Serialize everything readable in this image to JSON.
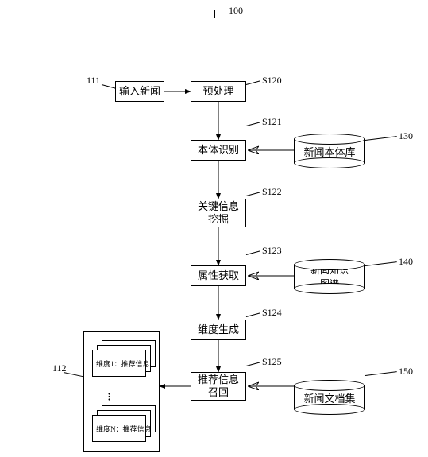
{
  "chart_data": {
    "type": "diagram",
    "title_label": "100",
    "nodes": [
      {
        "id": "111",
        "label_ref": "111",
        "text": "输入新闻"
      },
      {
        "id": "S120",
        "label_ref": "S120",
        "text": "预处理"
      },
      {
        "id": "S121",
        "label_ref": "S121",
        "text": "本体识别"
      },
      {
        "id": "S122",
        "label_ref": "S122",
        "text": "关键信息挖掘"
      },
      {
        "id": "S123",
        "label_ref": "S123",
        "text": "属性获取"
      },
      {
        "id": "S124",
        "label_ref": "S124",
        "text": "维度生成"
      },
      {
        "id": "S125",
        "label_ref": "S125",
        "text": "推荐信息召回"
      },
      {
        "id": "130",
        "label_ref": "130",
        "text": "新闻本体库",
        "shape": "cylinder"
      },
      {
        "id": "140",
        "label_ref": "140",
        "text": "新闻知识图谱",
        "shape": "cylinder"
      },
      {
        "id": "150",
        "label_ref": "150",
        "text": "新闻文档集",
        "shape": "cylinder"
      },
      {
        "id": "112",
        "label_ref": "112",
        "text_lines": [
          "维度1：推荐信息",
          "...",
          "维度N：推荐信息"
        ]
      }
    ],
    "edges": [
      {
        "from": "111",
        "to": "S120"
      },
      {
        "from": "S120",
        "to": "S121"
      },
      {
        "from": "S121",
        "to": "S122"
      },
      {
        "from": "S122",
        "to": "S123"
      },
      {
        "from": "S123",
        "to": "S124"
      },
      {
        "from": "S124",
        "to": "S125"
      },
      {
        "from": "130",
        "to": "S121",
        "style": "bold"
      },
      {
        "from": "140",
        "to": "S123",
        "style": "bold"
      },
      {
        "from": "150",
        "to": "S125",
        "style": "bold"
      },
      {
        "from": "S125",
        "to": "112"
      }
    ]
  },
  "labels": {
    "ref_100": "100",
    "ref_111": "111",
    "ref_112": "112",
    "ref_130": "130",
    "ref_140": "140",
    "ref_150": "150",
    "ref_S120": "S120",
    "ref_S121": "S121",
    "ref_S122": "S122",
    "ref_S123": "S123",
    "ref_S124": "S124",
    "ref_S125": "S125"
  },
  "boxes": {
    "input_news": "输入新闻",
    "preprocess": "预处理",
    "entity_rec": "本体识别",
    "key_info": "关键信息\n挖掘",
    "attr_get": "属性获取",
    "dim_gen": "维度生成",
    "rec_recall": "推荐信息\n召回"
  },
  "cylinders": {
    "c130": "新闻本体库",
    "c140": "新闻知识\n图谱",
    "c150": "新闻文档集"
  },
  "output": {
    "dim1": "维度1：推荐信息",
    "ellipsis": "...",
    "dimN": "维度N：推荐信息"
  }
}
